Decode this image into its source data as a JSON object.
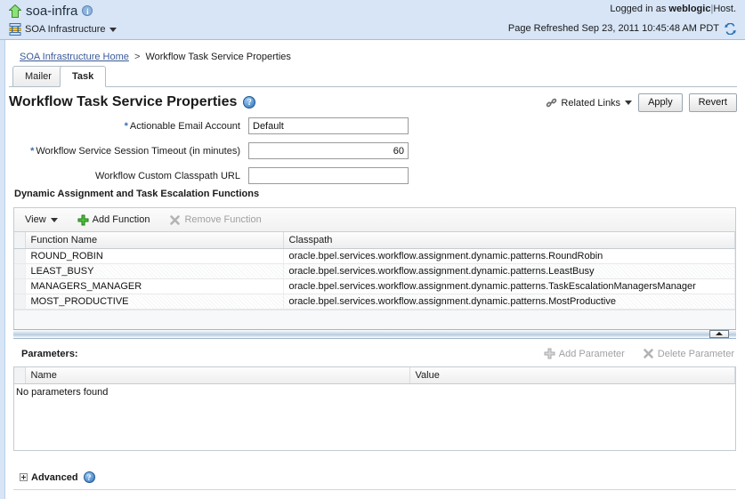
{
  "banner": {
    "app_title": "soa-infra",
    "app_info_icon": "info-icon",
    "home_icon": "home-up-arrow-icon",
    "infra_icon": "soa-infrastructure-icon",
    "infra_menu_label": "SOA Infrastructure",
    "logged_in_prefix": "Logged in as",
    "user": "weblogic",
    "separator": "|",
    "host_label": "Host",
    "host_suffix": ".",
    "page_refreshed": "Page Refreshed Sep 23, 2011 10:45:48 AM PDT",
    "refresh_icon": "refresh-icon"
  },
  "breadcrumb": {
    "home_label": "SOA Infrastructure Home",
    "separator": ">",
    "current": "Workflow Task Service Properties"
  },
  "tabs": [
    {
      "label": "Mailer",
      "active": false
    },
    {
      "label": "Task",
      "active": true
    }
  ],
  "page": {
    "title": "Workflow Task Service Properties",
    "help_icon": "help-question-icon"
  },
  "title_actions": {
    "related_links_label": "Related Links",
    "related_links_icon": "chain-link-icon",
    "apply_label": "Apply",
    "revert_label": "Revert"
  },
  "form": {
    "fields": [
      {
        "label": "Actionable Email Account",
        "required": true,
        "value": "Default",
        "numeric": false
      },
      {
        "label": "Workflow Service Session Timeout (in minutes)",
        "required": true,
        "value": "60",
        "numeric": true
      },
      {
        "label": "Workflow Custom Classpath URL",
        "required": false,
        "value": "",
        "numeric": false
      }
    ]
  },
  "functions_section": {
    "heading": "Dynamic Assignment and Task Escalation Functions",
    "toolbar": {
      "view_label": "View",
      "add_label": "Add Function",
      "add_icon": "plus-icon",
      "remove_label": "Remove Function",
      "remove_icon": "x-cross-icon",
      "remove_disabled": true
    },
    "columns": [
      "Function Name",
      "Classpath"
    ],
    "rows": [
      {
        "name": "ROUND_ROBIN",
        "classpath": "oracle.bpel.services.workflow.assignment.dynamic.patterns.RoundRobin"
      },
      {
        "name": "LEAST_BUSY",
        "classpath": "oracle.bpel.services.workflow.assignment.dynamic.patterns.LeastBusy"
      },
      {
        "name": "MANAGERS_MANAGER",
        "classpath": "oracle.bpel.services.workflow.assignment.dynamic.patterns.TaskEscalationManagersManager"
      },
      {
        "name": "MOST_PRODUCTIVE",
        "classpath": "oracle.bpel.services.workflow.assignment.dynamic.patterns.MostProductive"
      }
    ]
  },
  "splitter": {
    "collapse_icon": "collapse-up-arrow-icon"
  },
  "parameters_section": {
    "heading": "Parameters:",
    "add_label": "Add Parameter",
    "add_icon": "plus-icon",
    "delete_label": "Delete Parameter",
    "delete_icon": "x-cross-icon",
    "columns": [
      "Name",
      "Value"
    ],
    "empty_message": "No parameters found",
    "rows": []
  },
  "advanced": {
    "label": "Advanced",
    "expand_icon": "expand-plus-box-icon",
    "help_icon": "help-question-icon"
  },
  "colors": {
    "banner_bg": "#d7e5f7",
    "link": "#3b5998",
    "required_star": "#3b6fb0",
    "add_icon_green": "#49b43a",
    "disabled_text": "#a0a0a0"
  }
}
